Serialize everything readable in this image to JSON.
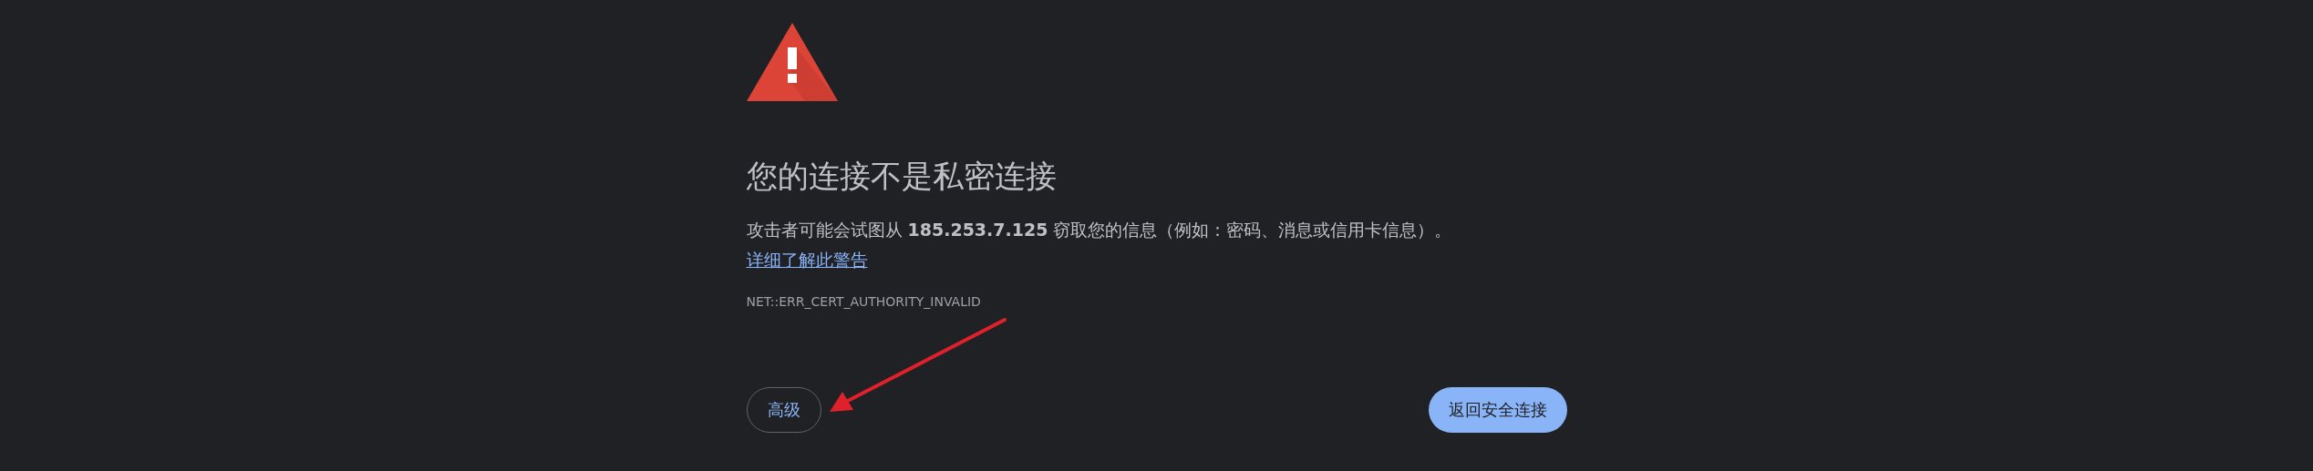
{
  "interstitial": {
    "heading": "您的连接不是私密连接",
    "message": "攻击者可能会试图从 **185.253.7.125** 窃取您的信息（例如：密码、消息或信用卡信息）。",
    "learn_more_link": "详细了解此警告",
    "error_code": "NET::ERR_CERT_AUTHORITY_INVALID",
    "buttons": [
      {
        "label": "高级",
        "kind": "secondary"
      },
      {
        "label": "返回安全连接",
        "kind": "primary"
      }
    ]
  }
}
